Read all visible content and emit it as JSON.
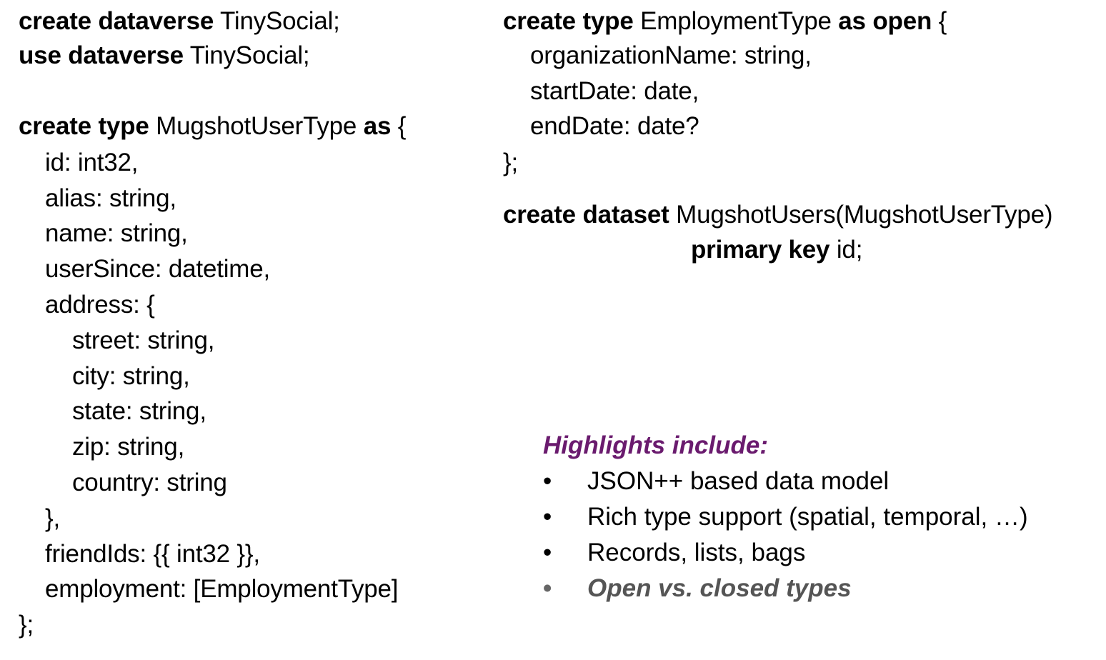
{
  "left_code": [
    {
      "kw": "create dataverse",
      "rest": " TinySocial;"
    },
    {
      "kw": "use dataverse",
      "rest": " TinySocial;"
    },
    {
      "kw": "create type",
      "rest": " MugshotUserType ",
      "kw2": "as",
      "rest2": " {"
    },
    {
      "text": "id: int32,"
    },
    {
      "text": "alias: string,"
    },
    {
      "text": "name: string,"
    },
    {
      "text": "userSince: datetime,"
    },
    {
      "text": "address: {"
    },
    {
      "text": "street: string,"
    },
    {
      "text": "city: string,"
    },
    {
      "text": "state: string,"
    },
    {
      "text": "zip: string,"
    },
    {
      "text": "country: string"
    },
    {
      "text": "},"
    },
    {
      "text": "friendIds: {{ int32 }},"
    },
    {
      "text": "employment: [EmploymentType]"
    },
    {
      "text": "};"
    }
  ],
  "right_code": [
    {
      "kw": "create type",
      "rest": " EmploymentType ",
      "kw2": "as open",
      "rest2": " {"
    },
    {
      "text": "organizationName: string,"
    },
    {
      "text": "startDate: date,"
    },
    {
      "text": "endDate: date?"
    },
    {
      "text": "};"
    },
    {
      "kw": "create dataset",
      "rest": " MugshotUsers(MugshotUserType)"
    },
    {
      "kw": "primary key",
      "rest": " id;"
    }
  ],
  "highlights": {
    "title": "Highlights include:",
    "bullet_char": "•",
    "items": [
      "JSON++ based data model",
      "Rich type support (spatial, temporal, …)",
      "Records, lists, bags",
      "Open vs. closed types"
    ]
  },
  "colors": {
    "highlight_title": "#6a1b6e",
    "last_bullet": "#555555"
  }
}
